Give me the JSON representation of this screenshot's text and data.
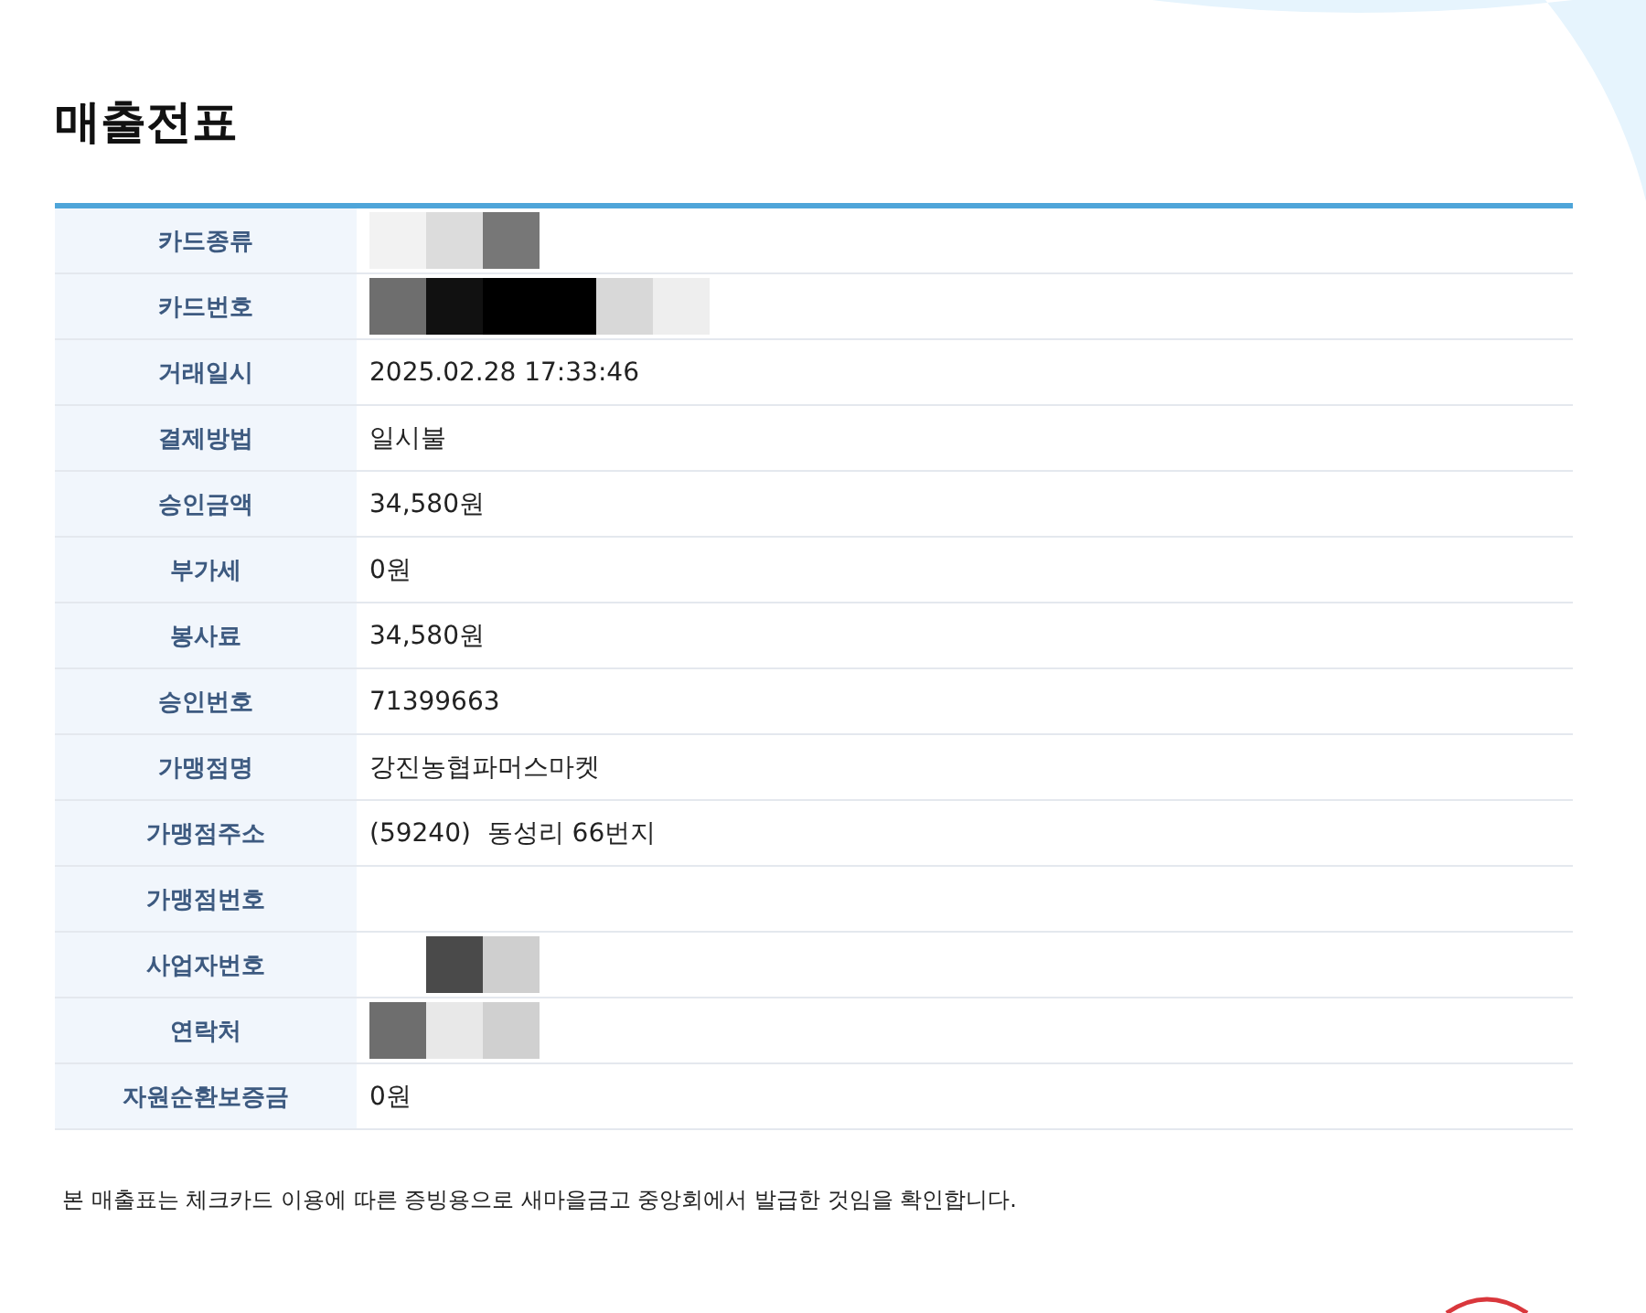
{
  "title": "매출전표",
  "rows": [
    {
      "label": "카드종류",
      "redacted": true
    },
    {
      "label": "카드번호",
      "redacted": true
    },
    {
      "label": "거래일시",
      "value": "2025.02.28 17:33:46",
      "redacted": false
    },
    {
      "label": "결제방법",
      "value": "일시불",
      "redacted": false
    },
    {
      "label": "승인금액",
      "value": "34,580원",
      "redacted": false
    },
    {
      "label": "부가세",
      "value": "0원",
      "redacted": false
    },
    {
      "label": "봉사료",
      "value": "34,580원",
      "redacted": false
    },
    {
      "label": "승인번호",
      "value": "71399663",
      "redacted": false
    },
    {
      "label": "가맹점명",
      "value": "강진농협파머스마켓",
      "redacted": false
    },
    {
      "label": "가맹점주소",
      "value": "(59240)  동성리 66번지",
      "redacted": false
    },
    {
      "label": "가맹점번호",
      "redacted": false
    },
    {
      "label": "사업자번호",
      "redacted": true
    },
    {
      "label": "연락처",
      "redacted": true
    },
    {
      "label": "자원순환보증금",
      "value": "0원",
      "redacted": false
    }
  ],
  "notice": "본 매출표는 체크카드 이용에 따른 증빙용으로 새마을금고 중앙회에서 발급한 것임을 확인합니다."
}
